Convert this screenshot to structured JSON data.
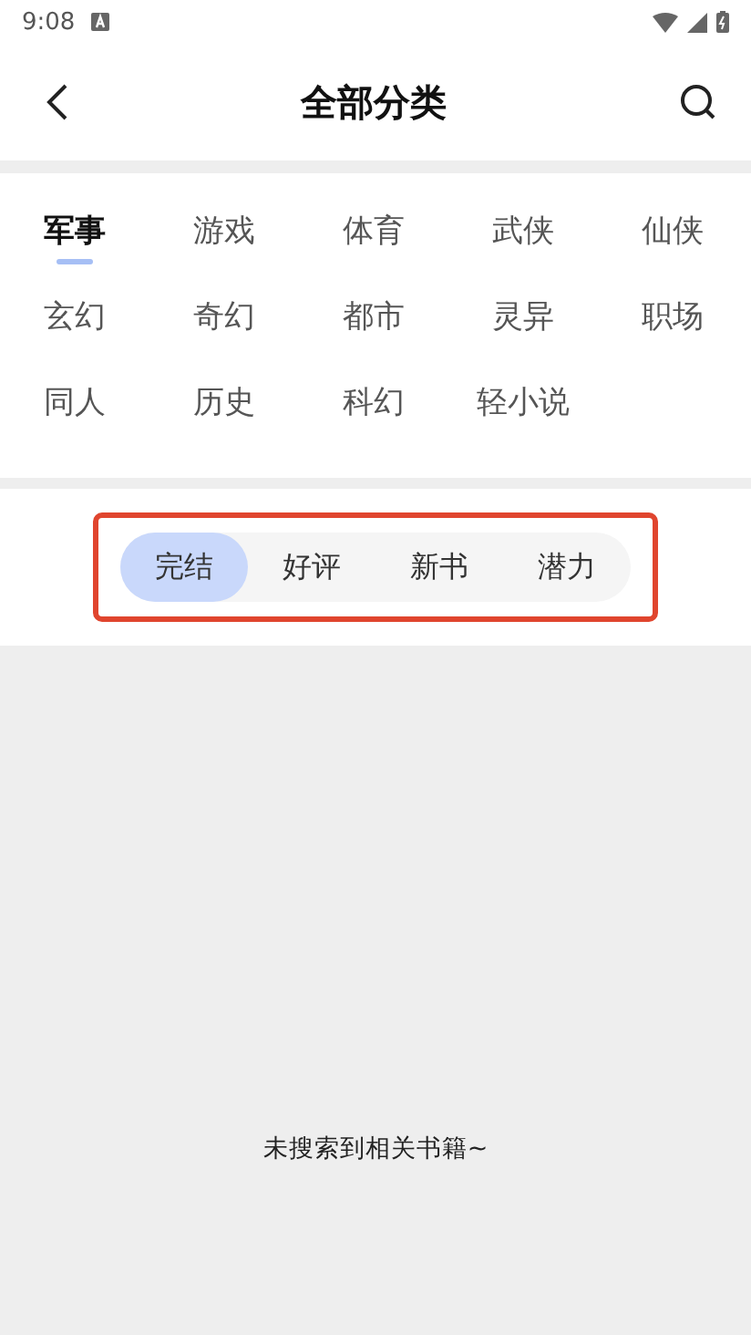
{
  "status_bar": {
    "time": "9:08"
  },
  "header": {
    "title": "全部分类"
  },
  "categories": [
    {
      "label": "军事",
      "selected": true
    },
    {
      "label": "游戏",
      "selected": false
    },
    {
      "label": "体育",
      "selected": false
    },
    {
      "label": "武侠",
      "selected": false
    },
    {
      "label": "仙侠",
      "selected": false
    },
    {
      "label": "玄幻",
      "selected": false
    },
    {
      "label": "奇幻",
      "selected": false
    },
    {
      "label": "都市",
      "selected": false
    },
    {
      "label": "灵异",
      "selected": false
    },
    {
      "label": "职场",
      "selected": false
    },
    {
      "label": "同人",
      "selected": false
    },
    {
      "label": "历史",
      "selected": false
    },
    {
      "label": "科幻",
      "selected": false
    },
    {
      "label": "轻小说",
      "selected": false
    }
  ],
  "filters": [
    {
      "label": "完结",
      "selected": true
    },
    {
      "label": "好评",
      "selected": false
    },
    {
      "label": "新书",
      "selected": false
    },
    {
      "label": "潜力",
      "selected": false
    }
  ],
  "empty_message": "未搜索到相关书籍~"
}
